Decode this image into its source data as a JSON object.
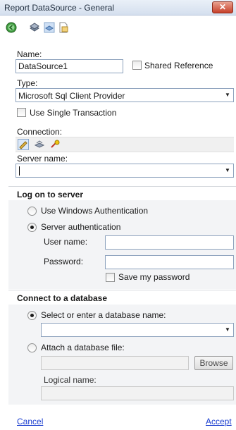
{
  "window": {
    "title": "Report DataSource - General",
    "close_glyph": "✕"
  },
  "toolbar": {
    "icons": [
      "back-icon",
      "database-icon",
      "database-edit-icon",
      "document-icon"
    ]
  },
  "name": {
    "label": "Name:",
    "value": "DataSource1"
  },
  "shared_reference": {
    "label": "Shared Reference",
    "checked": false
  },
  "type": {
    "label": "Type:",
    "value": "Microsoft Sql Client Provider"
  },
  "single_transaction": {
    "label": "Use Single Transaction",
    "checked": false
  },
  "connection": {
    "label": "Connection:",
    "icons": [
      "connection-edit-icon",
      "connection-test-icon",
      "connection-build-icon"
    ]
  },
  "server": {
    "label": "Server name:",
    "value": ""
  },
  "logon": {
    "heading": "Log on to server",
    "windows_auth_label": "Use Windows Authentication",
    "server_auth_label": "Server authentication",
    "selected": "server",
    "username_label": "User name:",
    "username_value": "",
    "password_label": "Password:",
    "password_value": "",
    "save_password_label": "Save my password",
    "save_password_checked": false
  },
  "database": {
    "heading": "Connect to a database",
    "select_label": "Select or enter a database name:",
    "select_value": "",
    "attach_label": "Attach a database file:",
    "attach_value": "",
    "browse_label": "Browse",
    "logical_name_label": "Logical name:",
    "logical_name_value": "",
    "selected": "select"
  },
  "footer": {
    "cancel_label": "Cancel",
    "accept_label": "Accept"
  },
  "colors": {
    "link": "#1c3fd0",
    "close": "#c7402a",
    "section_bg": "#f3f4f6"
  }
}
